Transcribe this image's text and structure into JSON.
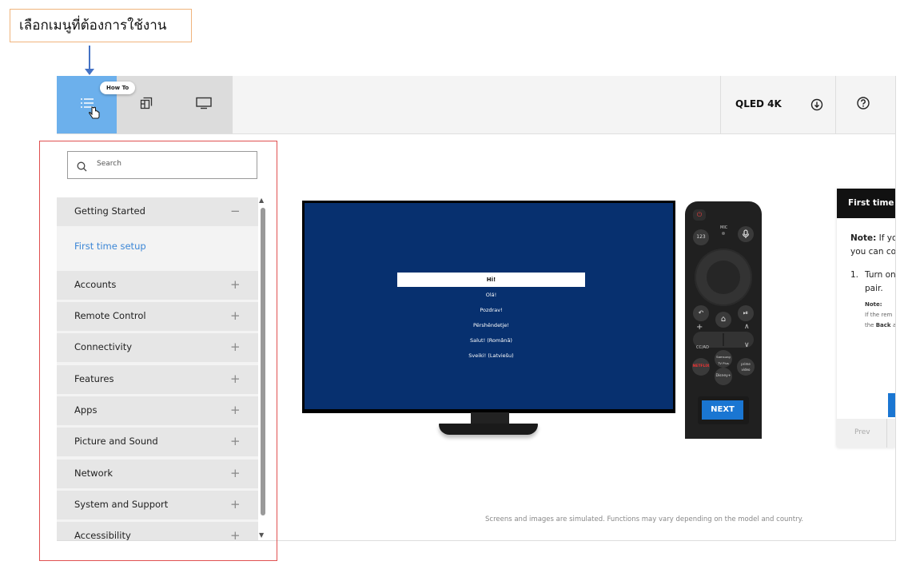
{
  "annotation": {
    "callout_text": "เลือกเมนูที่ต้องการใช้งาน",
    "highlight_color": "#e05050"
  },
  "toolbar": {
    "tooltip": "How To",
    "tabs": [
      {
        "icon": "list-icon",
        "active": true
      },
      {
        "icon": "layout-icon",
        "active": false
      },
      {
        "icon": "tv-icon",
        "active": false
      }
    ],
    "model": "QLED 4K",
    "active_color": "#6cb0ec"
  },
  "sidebar": {
    "search_placeholder": "Search",
    "categories": [
      {
        "label": "Getting Started",
        "sign": "−",
        "expanded": true
      },
      {
        "label": "Accounts",
        "sign": "+"
      },
      {
        "label": "Remote Control",
        "sign": "+"
      },
      {
        "label": "Connectivity",
        "sign": "+"
      },
      {
        "label": "Features",
        "sign": "+"
      },
      {
        "label": "Apps",
        "sign": "+"
      },
      {
        "label": "Picture and Sound",
        "sign": "+"
      },
      {
        "label": "Network",
        "sign": "+"
      },
      {
        "label": "System and Support",
        "sign": "+"
      },
      {
        "label": "Accessibility",
        "sign": "+"
      }
    ],
    "sub_item": "First time setup",
    "scroll_up": "▲",
    "scroll_down": "▼"
  },
  "tv": {
    "languages": [
      "Hi!",
      "Olá!",
      "Pozdrav!",
      "Përshëndetje!",
      "Salut! (Română)",
      "Sveiki! (Latviešu)"
    ],
    "screen_color": "#07306f"
  },
  "remote": {
    "next_label": "NEXT",
    "power": "⏻",
    "num_label": "123",
    "mic_label": "MIC",
    "back": "↶",
    "home": "⌂",
    "play": "⏯",
    "plus": "+",
    "up": "∧",
    "down": "∨",
    "cc": "CC/AD",
    "netflix": "NETFLIX",
    "samsung_tv_plus": "Samsung TV Plus",
    "prime": "prime video",
    "disney": "Disney+"
  },
  "guide": {
    "title": "First time s",
    "note_bold": "Note:",
    "note_line1": " If you",
    "note_line2": "you can con",
    "step_num": "1.",
    "step_line1": "Turn on",
    "step_line2": "pair.",
    "small_note": "Note:",
    "small_line1": "If the rem",
    "small_line2": "the ",
    "small_bold": "Back",
    "small_tail": " a",
    "prev_label": "Prev"
  },
  "footer": {
    "disclaimer": "Screens and images are simulated. Functions may vary depending on the model and country."
  }
}
